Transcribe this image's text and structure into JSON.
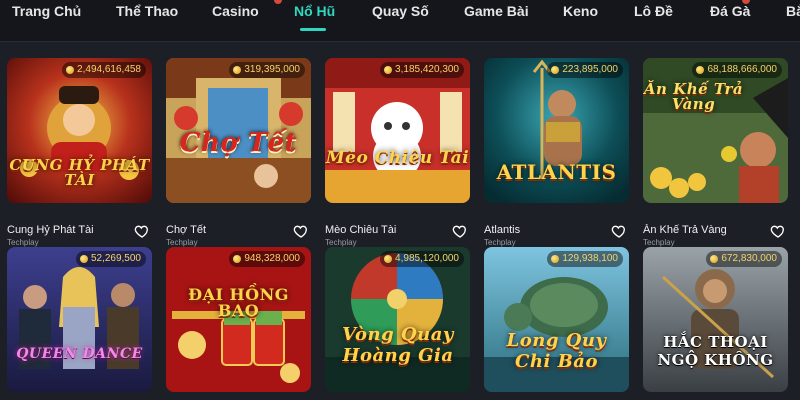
{
  "nav": {
    "items": [
      {
        "label": "Trang Chủ"
      },
      {
        "label": "Thể Thao"
      },
      {
        "label": "Casino"
      },
      {
        "label": "Nổ Hũ"
      },
      {
        "label": "Quay Số"
      },
      {
        "label": "Game Bài"
      },
      {
        "label": "Keno"
      },
      {
        "label": "Lô Đề"
      },
      {
        "label": "Đá Gà"
      },
      {
        "label": "Bắ"
      }
    ],
    "active": "Nổ Hũ",
    "accent": "#2fd7c0"
  },
  "games": [
    {
      "name": "Cung Hỷ Phát Tài",
      "provider": "Techplay",
      "jackpot": "2,494,616,458",
      "art_title": "CUNG HỶ PHÁT TÀI",
      "icon": "heart-icon"
    },
    {
      "name": "Chợ Tết",
      "provider": "Techplay",
      "jackpot": "319,395,000",
      "art_title": "Chợ Tết",
      "icon": "heart-icon"
    },
    {
      "name": "Mèo Chiêu Tài",
      "provider": "Techplay",
      "jackpot": "3,185,420,300",
      "art_title": "Mèo Chiêu Tài",
      "icon": "heart-icon"
    },
    {
      "name": "Atlantis",
      "provider": "Techplay",
      "jackpot": "223,895,000",
      "art_title": "ATLANTIS",
      "icon": "heart-icon"
    },
    {
      "name": "Ăn Khế Trả Vàng",
      "provider": "Techplay",
      "jackpot": "68,188,666,000",
      "art_title": "Ăn Khế Trả Vàng",
      "icon": "heart-icon"
    },
    {
      "name": "",
      "provider": "",
      "jackpot": "52,269,500",
      "art_title": "QUEEN DANCE",
      "icon": "heart-icon"
    },
    {
      "name": "",
      "provider": "",
      "jackpot": "948,328,000",
      "art_title": "ĐẠI HỒNG BAO",
      "icon": "heart-icon"
    },
    {
      "name": "",
      "provider": "",
      "jackpot": "4,985,120,000",
      "art_title": "Vòng Quay Hoàng Gia",
      "icon": "heart-icon"
    },
    {
      "name": "",
      "provider": "",
      "jackpot": "129,938,100",
      "art_title": "Long Quy Chi Bảo",
      "icon": "heart-icon"
    },
    {
      "name": "",
      "provider": "",
      "jackpot": "672,830,000",
      "art_title": "HẮC THOẠI NGỘ KHÔNG",
      "icon": "heart-icon"
    }
  ],
  "colors": {
    "background": "#1d1f26",
    "jackpot_text": "#f5d36a"
  }
}
